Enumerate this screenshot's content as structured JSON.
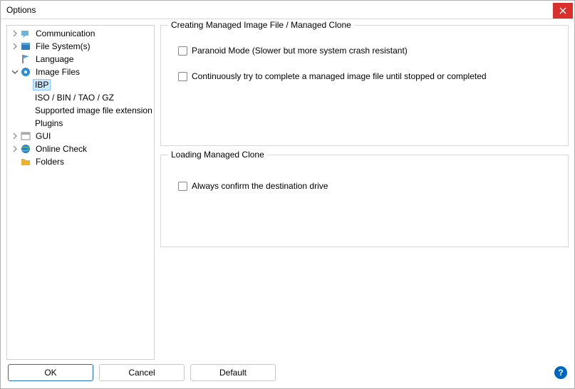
{
  "window": {
    "title": "Options"
  },
  "tree": {
    "items": [
      {
        "label": "Communication",
        "iconColor": "#5aa8d0"
      },
      {
        "label": "File System(s)",
        "iconColor": "#2e7dc2"
      },
      {
        "label": "Language",
        "iconColor": "#4aa3dd"
      },
      {
        "label": "Image Files",
        "iconColor": "#2a8fd6"
      },
      {
        "label": "IBP"
      },
      {
        "label": "ISO / BIN / TAO / GZ"
      },
      {
        "label": "Supported image file extension"
      },
      {
        "label": "Plugins"
      },
      {
        "label": "GUI",
        "iconColor": "#888888"
      },
      {
        "label": "Online Check",
        "iconColor": "#1f7fd1"
      },
      {
        "label": "Folders",
        "iconColor": "#f0b028"
      }
    ]
  },
  "groups": {
    "creating": {
      "legend": "Creating Managed Image File / Managed Clone",
      "checks": [
        "Paranoid Mode (Slower but more system crash resistant)",
        "Continuously try to complete a managed image file until stopped or completed"
      ]
    },
    "loading": {
      "legend": "Loading Managed Clone",
      "checks": [
        "Always confirm the destination drive"
      ]
    }
  },
  "buttons": {
    "ok": "OK",
    "cancel": "Cancel",
    "default_": "Default"
  }
}
